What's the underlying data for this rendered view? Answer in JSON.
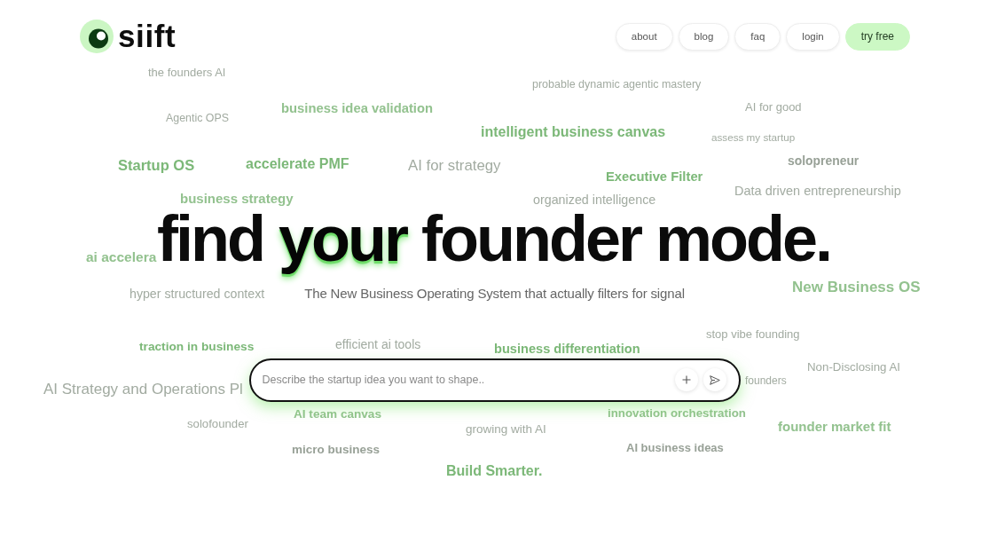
{
  "brand": {
    "name": "siift"
  },
  "nav": [
    {
      "label": "about",
      "kind": "link"
    },
    {
      "label": "blog",
      "kind": "link"
    },
    {
      "label": "faq",
      "kind": "link"
    },
    {
      "label": "login",
      "kind": "link"
    },
    {
      "label": "try free",
      "kind": "cta"
    }
  ],
  "hero": {
    "headline": [
      {
        "text": "find",
        "highlighted": false
      },
      {
        "text": "your",
        "highlighted": true
      },
      {
        "text": "founder mode.",
        "highlighted": false
      }
    ],
    "subtitle": "The New Business Operating System that actually filters for signal",
    "prompt": {
      "placeholder": "Describe the startup idea you want to shape.."
    }
  },
  "background_words": [
    "the founders AI",
    "probable dynamic agentic mastery",
    "Agentic OPS",
    "business idea validation",
    "AI for good",
    "intelligent business canvas",
    "assess my startup",
    "Startup OS",
    "accelerate PMF",
    "AI for strategy",
    "Executive Filter",
    "solopreneur",
    "Data driven entrepreneurship",
    "business strategy",
    "organized intelligence",
    "ai accelera",
    "hyper structured context",
    "New Business OS",
    "traction in business",
    "efficient ai tools",
    "business differentiation",
    "stop vibe founding",
    "AI Strategy and Operations Pl",
    "founders",
    "Non-Disclosing AI",
    "solofounder",
    "AI team canvas",
    "growing with AI",
    "innovation orchestration",
    "founder market fit",
    "micro business",
    "AI business ideas",
    "Build Smarter."
  ]
}
